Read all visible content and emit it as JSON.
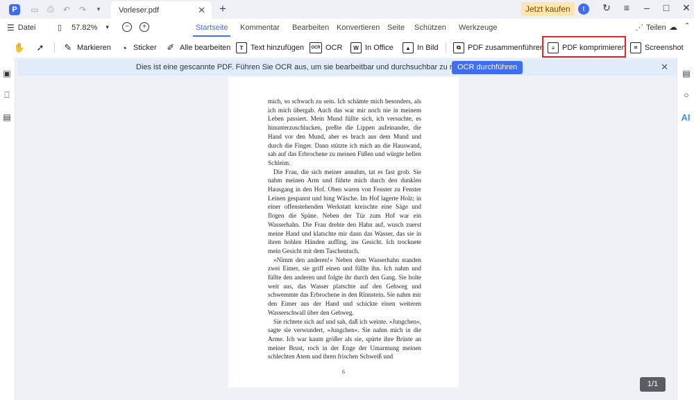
{
  "titlebar": {
    "app_logo": "P",
    "tab_title": "Vorleser.pdf",
    "tab_close": "✕",
    "tab_add": "+",
    "buy_label": "Jetzt kaufen",
    "avatar_letter": "t"
  },
  "menubar": {
    "file_label": "Datei",
    "zoom_value": "57.82%",
    "tabs": [
      "Startseite",
      "Kommentar",
      "Bearbeiten",
      "Konvertieren",
      "Seite",
      "Schützen",
      "Werkzeuge"
    ],
    "active_tab": "Startseite",
    "share_label": "Teilen"
  },
  "toolbar": {
    "tools": [
      {
        "label": "Markieren",
        "icon": "highlighter-icon"
      },
      {
        "label": "Sticker",
        "icon": "sticker-icon"
      },
      {
        "label": "Alle bearbeiten",
        "icon": "edit-all-icon"
      },
      {
        "label": "Text hinzufügen",
        "icon": "add-text-icon"
      },
      {
        "label": "OCR",
        "icon": "ocr-icon"
      },
      {
        "label": "In Office",
        "icon": "to-office-icon"
      },
      {
        "label": "In Bild",
        "icon": "to-image-icon"
      },
      {
        "label": "PDF zusammenführen",
        "icon": "merge-pdf-icon"
      },
      {
        "label": "PDF komprimieren",
        "icon": "compress-pdf-icon"
      },
      {
        "label": "Screenshot",
        "icon": "screenshot-icon"
      }
    ],
    "ocr_icon_text": "OCR",
    "word_icon_text": "W"
  },
  "banner": {
    "text": "Dies ist eine gescannte PDF. Führen Sie OCR aus, um sie bearbeitbar und durchsuchbar zu machen.",
    "button_label": "OCR durchführen",
    "close": "✕"
  },
  "rightbar": {
    "ai_label": "AI"
  },
  "document": {
    "paragraphs": [
      "mich, so schwach zu sein. Ich schämte mich besonders, als ich mich übergab. Auch das war mir noch nie in meinem Leben passiert. Mein Mund füllte sich, ich versuchte, es hinunterzuschlucken, preßte die Lippen aufeinander, die Hand vor den Mund, aber es brach aus dem Mund und durch die Finger. Dann stützte ich mich an die Hauswand, sah auf das Erbrochene zu meinen Füßen und würgte hellen Schleim.",
      "Die Frau, die sich meiner annahm, tat es fast grob. Sie nahm meinen Arm und führte mich durch den dunklen Hausgang in den Hof. Oben waren von Fenster zu Fenster Leinen gespannt und hing Wäsche. Im Hof lagerte Holz; in einer offenstehenden Werkstatt kreischte eine Säge und flogen die Späne. Neben der Tür zum Hof war ein Wasserhahn. Die Frau drehte den Hahn auf, wusch zuerst meine Hand und klatschte mir dann das Wasser, das sie in ihren hohlen Händen auffing, ins Gesicht. Ich trocknete mein Gesicht mit dem Taschentuch.",
      "»Nimm den anderen!« Neben dem Wasserhahn standen zwei Eimer, sie griff einen und füllte ihn. Ich nahm und füllte den anderen und folgte ihr durch den Gang. Sie holte weit aus, das Wasser platschte auf den Gehweg und schwemmte das Erbrochene in den Rinnstein. Sie nahm mir den Eimer aus der Hand und schickte einen weiteren Wasserschwall über den Gehweg.",
      "Sie richtete sich auf und sah, daß ich weinte. »Jungchen«, sagte sie verwundert, »Jungchen«. Sie nahm mich in die Arme. Ich war kaum größer als sie, spürte ihre Brüste an meiner Brust, roch in der Enge der Umarmung meinen schlechten Atem und ihren frischen Schweiß und"
    ],
    "page_number": "6"
  },
  "pager": "1/1"
}
